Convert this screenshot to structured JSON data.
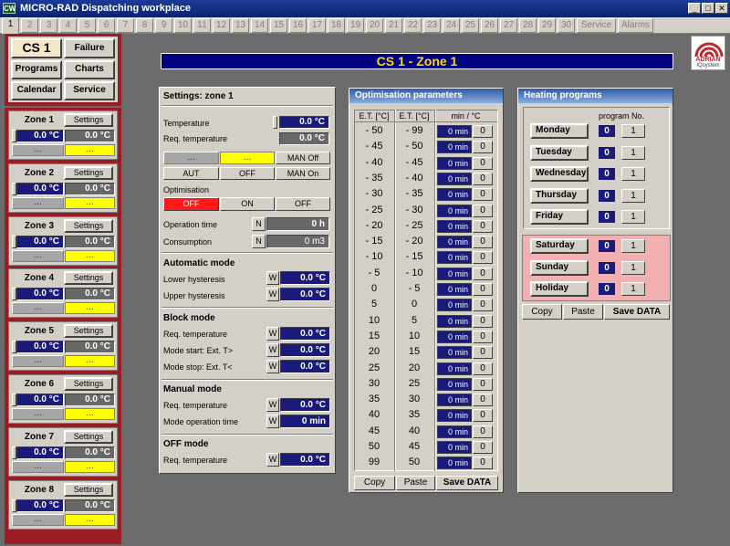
{
  "app": {
    "icon": "CW",
    "title": "MICRO-RAD  Dispatching workplace"
  },
  "tabs": [
    "1",
    "2",
    "3",
    "4",
    "5",
    "6",
    "7",
    "8",
    "9",
    "10",
    "11",
    "12",
    "13",
    "14",
    "15",
    "16",
    "17",
    "18",
    "19",
    "20",
    "21",
    "22",
    "23",
    "24",
    "25",
    "26",
    "27",
    "28",
    "29",
    "30",
    "Service",
    "Alarms"
  ],
  "nav": {
    "cs": "CS 1",
    "failure": "Failure",
    "programs": "Programs",
    "charts": "Charts",
    "calendar": "Calendar",
    "service": "Service"
  },
  "zones": [
    {
      "name": "Zone 1",
      "settings": "Settings",
      "v1": "0.0 °C",
      "v2": "0.0 °C",
      "dots": "...",
      "yel": "..."
    },
    {
      "name": "Zone 2",
      "settings": "Settings",
      "v1": "0.0 °C",
      "v2": "0.0 °C",
      "dots": "...",
      "yel": "..."
    },
    {
      "name": "Zone 3",
      "settings": "Settings",
      "v1": "0.0 °C",
      "v2": "0.0 °C",
      "dots": "...",
      "yel": "..."
    },
    {
      "name": "Zone 4",
      "settings": "Settings",
      "v1": "0.0 °C",
      "v2": "0.0 °C",
      "dots": "...",
      "yel": "..."
    },
    {
      "name": "Zone 5",
      "settings": "Settings",
      "v1": "0.0 °C",
      "v2": "0.0 °C",
      "dots": "...",
      "yel": "..."
    },
    {
      "name": "Zone 6",
      "settings": "Settings",
      "v1": "0.0 °C",
      "v2": "0.0 °C",
      "dots": "...",
      "yel": "..."
    },
    {
      "name": "Zone 7",
      "settings": "Settings",
      "v1": "0.0 °C",
      "v2": "0.0 °C",
      "dots": "...",
      "yel": "..."
    },
    {
      "name": "Zone 8",
      "settings": "Settings",
      "v1": "0.0 °C",
      "v2": "0.0 °C",
      "dots": "...",
      "yel": "..."
    }
  ],
  "header": "CS 1 - Zone 1",
  "logo": {
    "name": "ADRIAN",
    "sub": "IQsystem"
  },
  "settings": {
    "title": "Settings: zone 1",
    "temperature_label": "Temperature",
    "temperature": "0.0 °C",
    "req_temp_label": "Req. temperature",
    "req_temp": "0.0 °C",
    "dots": "...",
    "yel": "...",
    "man_off": "MAN Off",
    "aut": "AUT",
    "off": "OFF",
    "man_on": "MAN On",
    "optimisation_label": "Optimisation",
    "opt_off": "OFF",
    "opt_on": "ON",
    "opt_off2": "OFF",
    "op_time_label": "Operation time",
    "n": "N",
    "op_time": "0 h",
    "consumption_label": "Consumption",
    "consumption": "0 m3",
    "auto_mode": "Automatic mode",
    "lower_hyst_label": "Lower hysteresis",
    "w": "W",
    "lower_hyst": "0.0 °C",
    "upper_hyst_label": "Upper hysteresis",
    "upper_hyst": "0.0 °C",
    "block_mode": "Block mode",
    "block_req_label": "Req. temperature",
    "block_req": "0.0 °C",
    "mode_start_label": "Mode start:  Ext. T>",
    "mode_start": "0.0 °C",
    "mode_stop_label": "Mode stop:  Ext. T<",
    "mode_stop": "0.0 °C",
    "manual_mode": "Manual mode",
    "manual_req_label": "Req. temperature",
    "manual_req": "0.0 °C",
    "mode_op_time_label": "Mode operation time",
    "mode_op_time": "0 min",
    "off_mode": "OFF mode",
    "off_req_label": "Req. temperature",
    "off_req": "0.0 °C"
  },
  "optimisation": {
    "title": "Optimisation parameters",
    "col1": "E.T. [°C]",
    "col2": "E.T. [°C]",
    "col3": "min / °C",
    "rows": [
      {
        "a": "- 50",
        "b": "- 99",
        "m": "0 min",
        "z": "0"
      },
      {
        "a": "- 45",
        "b": "- 50",
        "m": "0 min",
        "z": "0"
      },
      {
        "a": "- 40",
        "b": "- 45",
        "m": "0 min",
        "z": "0"
      },
      {
        "a": "- 35",
        "b": "- 40",
        "m": "0 min",
        "z": "0"
      },
      {
        "a": "- 30",
        "b": "- 35",
        "m": "0 min",
        "z": "0"
      },
      {
        "a": "- 25",
        "b": "- 30",
        "m": "0 min",
        "z": "0"
      },
      {
        "a": "- 20",
        "b": "- 25",
        "m": "0 min",
        "z": "0"
      },
      {
        "a": "- 15",
        "b": "- 20",
        "m": "0 min",
        "z": "0"
      },
      {
        "a": "- 10",
        "b": "- 15",
        "m": "0 min",
        "z": "0"
      },
      {
        "a": "- 5",
        "b": "- 10",
        "m": "0 min",
        "z": "0"
      },
      {
        "a": "0",
        "b": "- 5",
        "m": "0 min",
        "z": "0"
      },
      {
        "a": "5",
        "b": "0",
        "m": "0 min",
        "z": "0"
      },
      {
        "a": "10",
        "b": "5",
        "m": "0 min",
        "z": "0"
      },
      {
        "a": "15",
        "b": "10",
        "m": "0 min",
        "z": "0"
      },
      {
        "a": "20",
        "b": "15",
        "m": "0 min",
        "z": "0"
      },
      {
        "a": "25",
        "b": "20",
        "m": "0 min",
        "z": "0"
      },
      {
        "a": "30",
        "b": "25",
        "m": "0 min",
        "z": "0"
      },
      {
        "a": "35",
        "b": "30",
        "m": "0 min",
        "z": "0"
      },
      {
        "a": "40",
        "b": "35",
        "m": "0 min",
        "z": "0"
      },
      {
        "a": "45",
        "b": "40",
        "m": "0 min",
        "z": "0"
      },
      {
        "a": "50",
        "b": "45",
        "m": "0 min",
        "z": "0"
      },
      {
        "a": "99",
        "b": "50",
        "m": "0 min",
        "z": "0"
      }
    ],
    "copy": "Copy",
    "paste": "Paste",
    "save": "Save DATA"
  },
  "heating": {
    "title": "Heating programs",
    "col": "program No.",
    "weekdays": [
      {
        "day": "Monday",
        "p": "0",
        "n": "1"
      },
      {
        "day": "Tuesday",
        "p": "0",
        "n": "1"
      },
      {
        "day": "Wednesday",
        "p": "0",
        "n": "1"
      },
      {
        "day": "Thursday",
        "p": "0",
        "n": "1"
      },
      {
        "day": "Friday",
        "p": "0",
        "n": "1"
      }
    ],
    "weekend": [
      {
        "day": "Saturday",
        "p": "0",
        "n": "1"
      },
      {
        "day": "Sunday",
        "p": "0",
        "n": "1"
      },
      {
        "day": "Holiday",
        "p": "0",
        "n": "1"
      }
    ],
    "copy": "Copy",
    "paste": "Paste",
    "save": "Save DATA"
  }
}
